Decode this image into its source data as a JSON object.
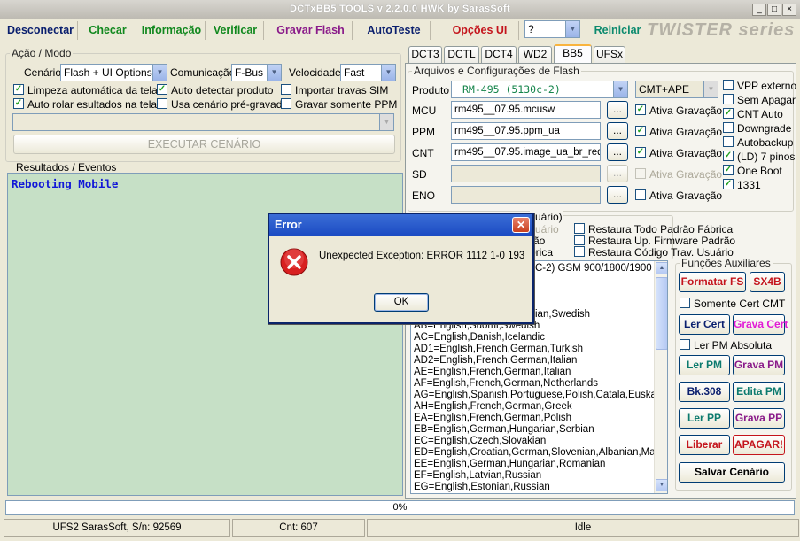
{
  "window": {
    "title": "DCTxBB5 TOOLS v 2.2.0.0 HWK by SarasSoft"
  },
  "menu": {
    "desconectar": "Desconectar",
    "checar": "Checar",
    "informacao": "Informação",
    "verificar": "Verificar",
    "gravar_flash": "Gravar Flash",
    "autoteste": "AutoTeste",
    "opcoes_ui": "Opções UI",
    "help_value": "?",
    "reiniciar": "Reiniciar",
    "brand": "TWISTER series"
  },
  "acao": {
    "legend": "Ação / Modo",
    "cenario_label": "Cenário",
    "cenario_value": "Flash + UI Options",
    "comunicacao_label": "Comunicação",
    "comunicacao_value": "F-Bus",
    "velocidade_label": "Velocidade",
    "velocidade_value": "Fast",
    "chk_limpeza": "Limpeza automática da tela",
    "chk_auto_detect": "Auto detectar produto",
    "chk_importar": "Importar travas SIM",
    "chk_auto_rolar": "Auto rolar esultados na tela",
    "chk_usa_cenario": "Usa cenário pré-gravado",
    "chk_gravar_pm": "Gravar somente PPM",
    "executar": "EXECUTAR CENÁRIO"
  },
  "resultados": {
    "legend": "Resultados / Eventos",
    "text": "Rebooting Mobile"
  },
  "tabs": [
    "DCT3",
    "DCTL",
    "DCT4",
    "WD2",
    "BB5",
    "UFSx"
  ],
  "arquivos": {
    "legend": "Arquivos e Configurações de Flash",
    "produto_label": "Produto",
    "produto_value": "RM-495 (5130c-2)",
    "cmt_value": "CMT+APE",
    "rows": [
      {
        "label": "MCU",
        "value": "rm495__07.95.mcusw",
        "btn": "...",
        "chk": "Ativa Gravação"
      },
      {
        "label": "PPM",
        "value": "rm495__07.95.ppm_ua",
        "btn": "...",
        "chk": "Ativa Gravação"
      },
      {
        "label": "CNT",
        "value": "rm495__07.95.image_ua_br_red",
        "btn": "...",
        "chk": "Ativa Gravação"
      },
      {
        "label": "SD",
        "value": "",
        "btn": "...",
        "chk": "Ativa Gravação"
      },
      {
        "label": "ENO",
        "value": "",
        "btn": "...",
        "chk": "Ativa Gravação"
      }
    ],
    "right_checks": [
      "VPP externo",
      "Sem Apagar",
      "CNT Auto",
      "Downgrade",
      "Autobackup",
      "(LD) 7 pinos",
      "One Boot",
      "1331"
    ]
  },
  "lower": {
    "partial_legend": "suário)",
    "partial_usuario": "suário",
    "partial_brica": "brica",
    "partial_rao": "rão",
    "restaura_fabrica": "Restaura Todo Padrão Fábrica",
    "restaura_firmware": "Restaura Up. Firmware Padrão",
    "restaura_codigo": "Restaura Código Trav. Usuário",
    "product_line": "C-2) GSM 900/1800/1900",
    "partial_swedish": "ian,Swedish",
    "languages": [
      "AB=English,Suomi,Swedish",
      "AC=English,Danish,Icelandic",
      "AD1=English,French,German,Turkish",
      "AD2=English,French,German,Italian",
      "AE=English,French,German,Italian",
      "AF=English,French,German,Netherlands",
      "AG=English,Spanish,Portuguese,Polish,Catala,Euskara,G",
      "AH=English,French,German,Greek",
      "EA=English,French,German,Polish",
      "EB=English,German,Hungarian,Serbian",
      "EC=English,Czech,Slovakian",
      "ED=English,Croatian,German,Slovenian,Albanian,Macedo",
      "EE=English,German,Hungarian,Romanian",
      "EF=English,Latvian,Russian",
      "EG=English,Estonian,Russian"
    ]
  },
  "funcoes": {
    "legend": "Funções Auxiliares",
    "formatar_fs": "Formatar FS",
    "sx4b": "SX4B",
    "somente_cert": "Somente Cert CMT",
    "ler_cert": "Ler Cert",
    "grava_cert": "Grava Cert",
    "ler_pm_absoluta": "Ler PM Absoluta",
    "ler_pm": "Ler PM",
    "grava_pm": "Grava PM",
    "bk308": "Bk.308",
    "edita_pm": "Edita PM",
    "ler_pp": "Ler PP",
    "grava_pp": "Grava PP",
    "liberar": "Liberar",
    "apagar": "APAGAR!",
    "salvar_cenario": "Salvar Cenário"
  },
  "progress": {
    "text": "0%",
    "value": 0
  },
  "status": {
    "serial": "UFS2 SarasSoft, S/n: 92569",
    "cnt": "Cnt: 607",
    "state": "Idle"
  },
  "dialog": {
    "title": "Error",
    "message": "Unexpected Exception:  ERROR 1112 1-0 193",
    "ok": "OK"
  }
}
